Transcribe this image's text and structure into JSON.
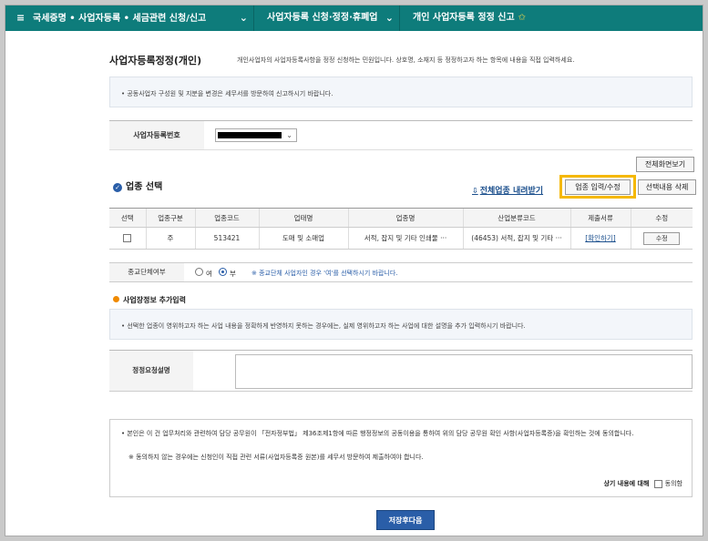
{
  "nav": {
    "seg1": "국세증명 • 사업자등록 • 세금관련 신청/신고",
    "seg2": "사업자등록 신청·정정·휴폐업",
    "seg3": "개인 사업자등록 정정 신고"
  },
  "header": {
    "title": "사업자등록정정(개인)",
    "desc": "개인사업자의 사업자등록사항을 정정 신청하는 민원입니다. 상호명, 소재지 등 정정하고자 하는 항목에 내용을 직접 입력하세요."
  },
  "notice1": "• 공동사업자 구성원 및 지분을 변경은 세무서를 방문하여 신고하시기 바랍니다.",
  "biz": {
    "label": "사업자등록번호"
  },
  "buttons": {
    "full_view": "전체화면보기",
    "edit": "업종 입력/수정",
    "delete": "선택내용 삭제",
    "save": "저장후다음"
  },
  "section": {
    "title": "업종 선택",
    "download": "전체업종 내려받기"
  },
  "table": {
    "headers": [
      "선택",
      "업종구분",
      "업종코드",
      "업태명",
      "업종명",
      "산업분류코드",
      "제출서류",
      "수정"
    ],
    "rows": [
      {
        "type": "주",
        "code": "513421",
        "biz": "도매 및 소매업",
        "item": "서적, 잡지 및 기타 인쇄물 ···",
        "industry": "(46453) 서적, 잡지 및 기타 ···",
        "doc": "[확인하기]",
        "edit": "수정"
      }
    ]
  },
  "joint": {
    "label": "종교단체여부",
    "yes": "여",
    "no": "부",
    "note": "※ 종교단체 사업자인 경우 '여'를 선택하시기 바랍니다."
  },
  "extra": {
    "title": "사업장정보 추가입력",
    "notice": "• 선택한 업종이 영위하고자 하는 사업 내용을 정확하게 반영하지 못하는 경우에는, 실제 영위하고자 하는 사업에 대한 설명을 추가 입력하시기 바랍니다.",
    "reason_label": "정정요청설명"
  },
  "consent": {
    "line1": "• 본인은 이 건 업무처리와 관련하여 담당 공무원이 「전자정부법」 제36조제1항에 따른 행정정보의 공동이용을 통하여 위의 담당 공무원 확인 사항(사업자등록증)을 확인하는 것에 동의합니다.",
    "line2": "※ 동의하지 않는 경우에는 신청인이 직접 관련 서류(사업자등록증 원본)를 세무서 방문하여 제출하여야 합니다.",
    "agree_label": "상기 내용에 대해",
    "agree_check": "동의함"
  }
}
